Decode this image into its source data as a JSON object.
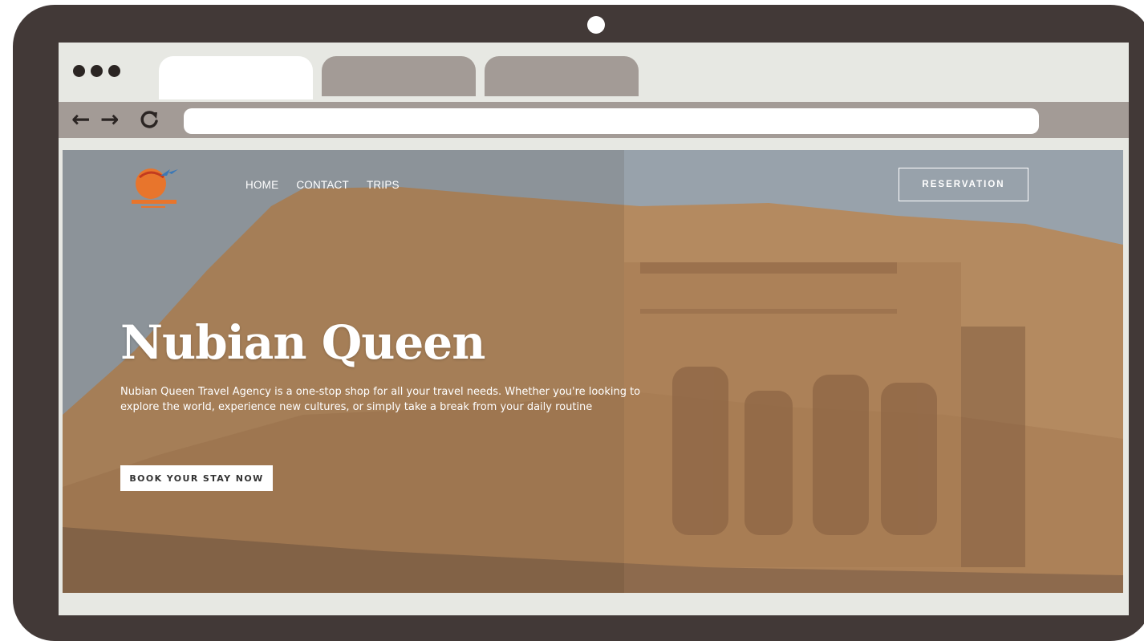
{
  "browser": {
    "tabs": [
      {
        "state": "active"
      },
      {
        "state": "inactive"
      },
      {
        "state": "inactive"
      }
    ],
    "icons": {
      "back": "←",
      "forward": "→",
      "reload": "⟳"
    },
    "address": ""
  },
  "site": {
    "logo_text": "NUBIAN QUEEN",
    "nav": [
      "HOME",
      "CONTACT",
      "TRIPS"
    ],
    "reservation_label": "RESERVATION",
    "hero": {
      "title": "Nubian Queen",
      "text": "Nubian Queen Travel Agency is a one-stop shop for all your travel needs. Whether you're looking to explore the world, experience new cultures, or simply take a break from your daily routine",
      "cta_label": "BOOK YOUR STAY NOW"
    }
  },
  "colors": {
    "frame": "#423937",
    "screen_bg": "#e7e8e3",
    "toolbar": "#a39b96",
    "logo_orange": "#e8752c"
  }
}
